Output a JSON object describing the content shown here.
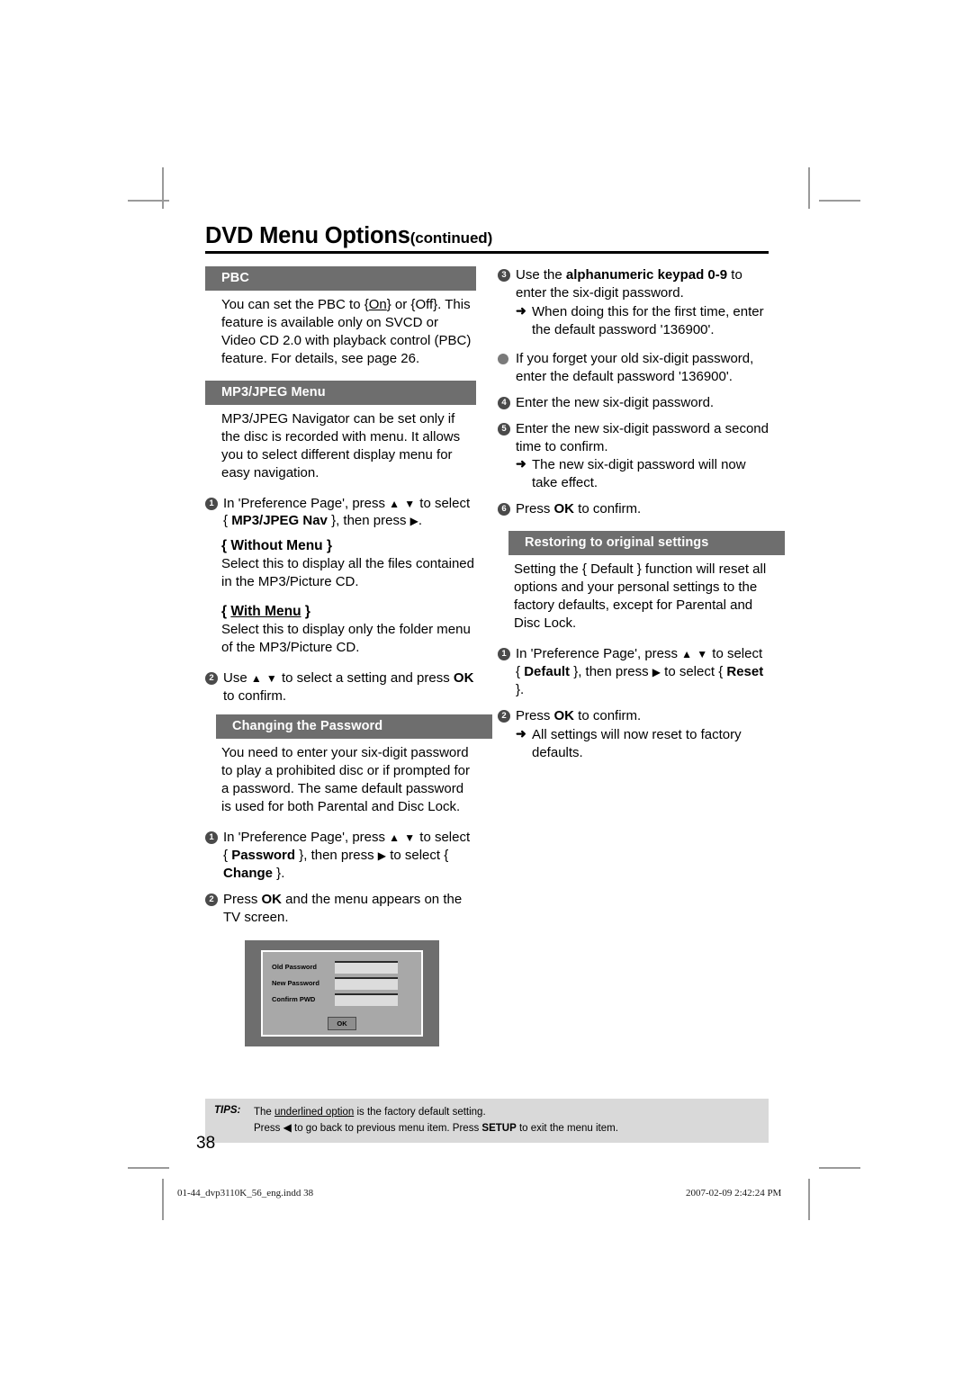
{
  "page": {
    "title_main": "DVD Menu Options",
    "title_sub": "(continued)",
    "page_number": "38",
    "bar_color": "#6e6e6e",
    "tips_bg": "#d9d9d9"
  },
  "left_column": {
    "pbc": {
      "heading": "PBC",
      "paragraph_1": "You can set the PBC to {",
      "paragraph_on": "On",
      "paragraph_2": "} or {Off}. This feature is available only on SVCD or Video CD 2.0 with playback control (PBC) feature. For details, see page 26."
    },
    "mp3jpeg": {
      "heading": "MP3/JPEG Menu",
      "intro": "MP3/JPEG Navigator can be set only if the disc is recorded with menu. It allows you to select different display menu for easy navigation.",
      "step1_a": "In 'Preference Page', press ",
      "step1_b": " to select { ",
      "step1_bold": "MP3/JPEG Nav",
      "step1_c": " }, then press ",
      "step1_d": ".",
      "without_menu_open": "{ ",
      "without_menu_label": "Without Menu",
      "without_menu_close": " }",
      "without_menu_text": "Select this to display all the files contained in the MP3/Picture CD.",
      "with_menu_open": "{ ",
      "with_menu_label": "With Menu",
      "with_menu_close": " }",
      "with_menu_text": "Select this to display only the folder menu of the MP3/Picture CD.",
      "step2_a": "Use ",
      "step2_b": " to select a setting and press ",
      "step2_bold": "OK",
      "step2_c": " to confirm."
    },
    "password": {
      "heading": "Changing the Password",
      "intro": "You need to enter your six-digit password to play a prohibited disc or if prompted for a password. The same default password is used for both Parental and Disc Lock.",
      "step1_a": "In 'Preference Page', press ",
      "step1_b": " to select { ",
      "step1_bold1": "Password",
      "step1_c": " }, then press ",
      "step1_d": " to select { ",
      "step1_bold2": "Change",
      "step1_e": " }.",
      "step2_a": "Press ",
      "step2_bold": "OK",
      "step2_b": " and the menu appears on the TV screen."
    },
    "screenshot": {
      "row_old": "Old Password",
      "row_new": "New Password",
      "row_confirm": "Confirm PWD",
      "ok_button": "OK"
    }
  },
  "right_column": {
    "steps": {
      "step3_a": "Use the ",
      "step3_bold": "alphanumeric keypad 0-9",
      "step3_b": " to enter the six-digit password.",
      "step3_arrow": "When doing this for the first time, enter the default password '136900'.",
      "bullet": "If you forget your old six-digit password, enter the default password '136900'.",
      "step4": "Enter the new six-digit password.",
      "step5": "Enter the new six-digit password a second time to confirm.",
      "step5_arrow": "The new six-digit password will now take effect.",
      "step6_a": "Press ",
      "step6_bold": "OK",
      "step6_b": " to confirm."
    },
    "restoring": {
      "heading": "Restoring to original settings",
      "intro": "Setting the { Default } function will reset all options and your personal settings to the factory defaults, except for Parental and Disc Lock.",
      "step1_a": "In 'Preference Page', press ",
      "step1_b": " to select { ",
      "step1_bold1": "Default",
      "step1_c": " }, then press ",
      "step1_d": " to select { ",
      "step1_bold2": "Reset",
      "step1_e": " }.",
      "step2_a": "Press ",
      "step2_bold": "OK",
      "step2_b": " to confirm.",
      "step2_arrow": "All settings will now reset to factory defaults."
    }
  },
  "tips": {
    "label": "TIPS:",
    "line1_a": "The ",
    "line1_underlined": "underlined option",
    "line1_b": " is the factory default setting.",
    "line2_a": "Press ",
    "line2_arrow": "◀",
    "line2_b": " to go back to previous menu item. Press ",
    "line2_bold": "SETUP",
    "line2_c": " to exit the menu item."
  },
  "print_footer": {
    "file": "01-44_dvp3110K_56_eng.indd   38",
    "timestamp": "2007-02-09   2:42:24 PM"
  },
  "icons": {
    "up_triangle": "▲",
    "down_triangle": "▼",
    "right_triangle": "▶",
    "left_triangle": "◀",
    "arrow_right": "➜"
  },
  "numbers": {
    "n1": "1",
    "n2": "2",
    "n3": "3",
    "n4": "4",
    "n5": "5",
    "n6": "6"
  }
}
